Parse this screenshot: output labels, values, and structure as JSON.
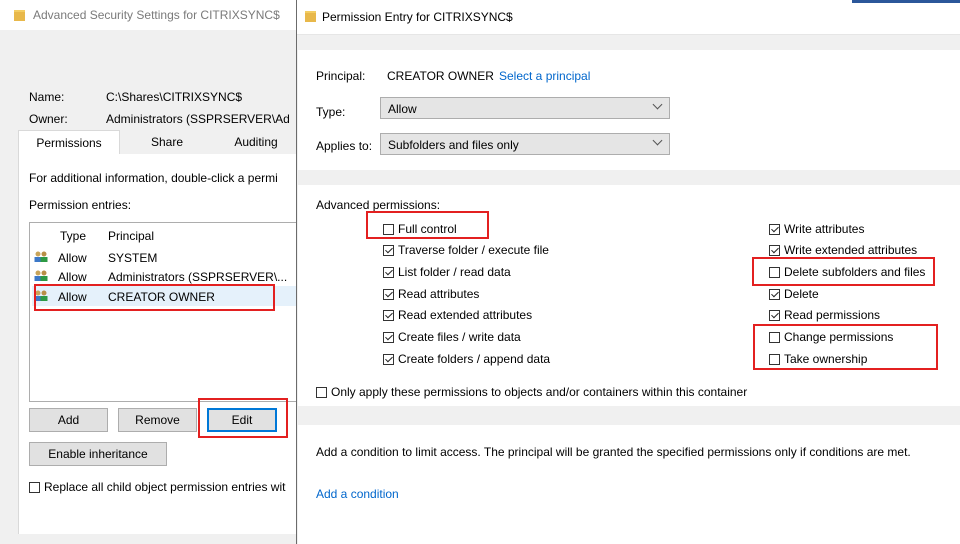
{
  "advanced_window": {
    "title": "Advanced Security Settings for CITRIXSYNC$",
    "name_label": "Name:",
    "name_value": "C:\\Shares\\CITRIXSYNC$",
    "owner_label": "Owner:",
    "owner_value": "Administrators (SSPRSERVER\\Ad",
    "tabs": [
      {
        "label": "Permissions"
      },
      {
        "label": "Share"
      },
      {
        "label": "Auditing"
      }
    ],
    "info_text": "For additional information, double-click a permi",
    "entries_label": "Permission entries:",
    "columns": {
      "type": "Type",
      "principal": "Principal"
    },
    "rows": [
      {
        "type": "Allow",
        "principal": "SYSTEM"
      },
      {
        "type": "Allow",
        "principal": "Administrators (SSPRSERVER\\..."
      },
      {
        "type": "Allow",
        "principal": "CREATOR OWNER"
      }
    ],
    "buttons": {
      "add": "Add",
      "remove": "Remove",
      "edit": "Edit",
      "enable_inheritance": "Enable inheritance"
    },
    "replace_label": "Replace all child object permission entries wit",
    "replace_checked": false
  },
  "permission_entry": {
    "title": "Permission Entry for CITRIXSYNC$",
    "principal_label": "Principal:",
    "principal_value": "CREATOR OWNER",
    "select_principal": "Select a principal",
    "type_label": "Type:",
    "type_value": "Allow",
    "applies_label": "Applies to:",
    "applies_value": "Subfolders and files only",
    "advanced_label": "Advanced permissions:",
    "perms_left": [
      {
        "label": "Full control",
        "checked": false
      },
      {
        "label": "Traverse folder / execute file",
        "checked": true
      },
      {
        "label": "List folder / read data",
        "checked": true
      },
      {
        "label": "Read attributes",
        "checked": true
      },
      {
        "label": "Read extended attributes",
        "checked": true
      },
      {
        "label": "Create files / write data",
        "checked": true
      },
      {
        "label": "Create folders / append data",
        "checked": true
      }
    ],
    "perms_right": [
      {
        "label": "Write attributes",
        "checked": true
      },
      {
        "label": "Write extended attributes",
        "checked": true
      },
      {
        "label": "Delete subfolders and files",
        "checked": false
      },
      {
        "label": "Delete",
        "checked": true
      },
      {
        "label": "Read permissions",
        "checked": true
      },
      {
        "label": "Change permissions",
        "checked": false
      },
      {
        "label": "Take ownership",
        "checked": false
      }
    ],
    "only_apply_label": "Only apply these permissions to objects and/or containers within this container",
    "only_apply_checked": false,
    "condition_text": "Add a condition to limit access. The principal will be granted the specified permissions only if conditions are met.",
    "add_condition": "Add a condition"
  },
  "colors": {
    "highlight_red": "#e32020",
    "link_blue": "#0066cc",
    "focus_blue": "#0078d7"
  }
}
